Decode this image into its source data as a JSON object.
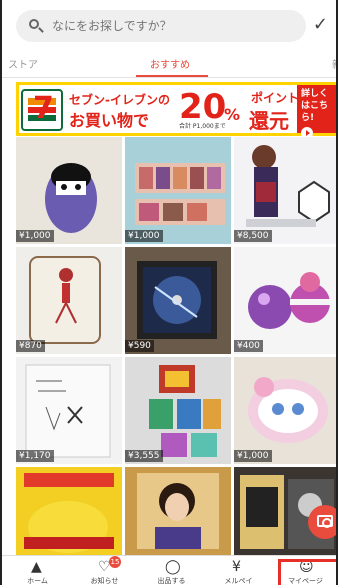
{
  "search": {
    "placeholder": "なにをお探しですか？",
    "check_glyph": "✓"
  },
  "tabs": {
    "left": "ストア",
    "active": "おすすめ",
    "right": "新"
  },
  "banner": {
    "line1": "セブン-イレブンの",
    "line2": "お買い物で",
    "big": "20",
    "percent": "%",
    "note": "合計 P1,000まで",
    "point": "ポイント",
    "kangen": "還元",
    "side": "詳しくはこちら!",
    "brand_color": "#e2231a",
    "frame_color": "#ffd200"
  },
  "items": [
    {
      "price": "¥1,000",
      "color": "#e9e4dc"
    },
    {
      "price": "¥1,000",
      "color": "#a8d0d8"
    },
    {
      "price": "¥8,500",
      "color": "#f3f3f5"
    },
    {
      "price": "¥870",
      "color": "#efeeea"
    },
    {
      "price": "¥590",
      "color": "#6a5a4a"
    },
    {
      "price": "¥400",
      "color": "#f5f5f5"
    },
    {
      "price": "¥1,170",
      "color": "#f2f2f2"
    },
    {
      "price": "¥3,555",
      "color": "#dcdcdc"
    },
    {
      "price": "¥1,000",
      "color": "#e9e2d8"
    },
    {
      "price": "",
      "color": "#f2cf22"
    },
    {
      "price": "",
      "color": "#c89a4a"
    },
    {
      "price": "",
      "color": "#3a3530"
    }
  ],
  "camera": {
    "icon": "camera-icon"
  },
  "nav": {
    "home_label": "ホーム",
    "notify_label": "お知らせ",
    "notify_badge": "15",
    "sell_label": "出品する",
    "mercari_label": "メルペイ",
    "mypage_label": "マイページ"
  }
}
